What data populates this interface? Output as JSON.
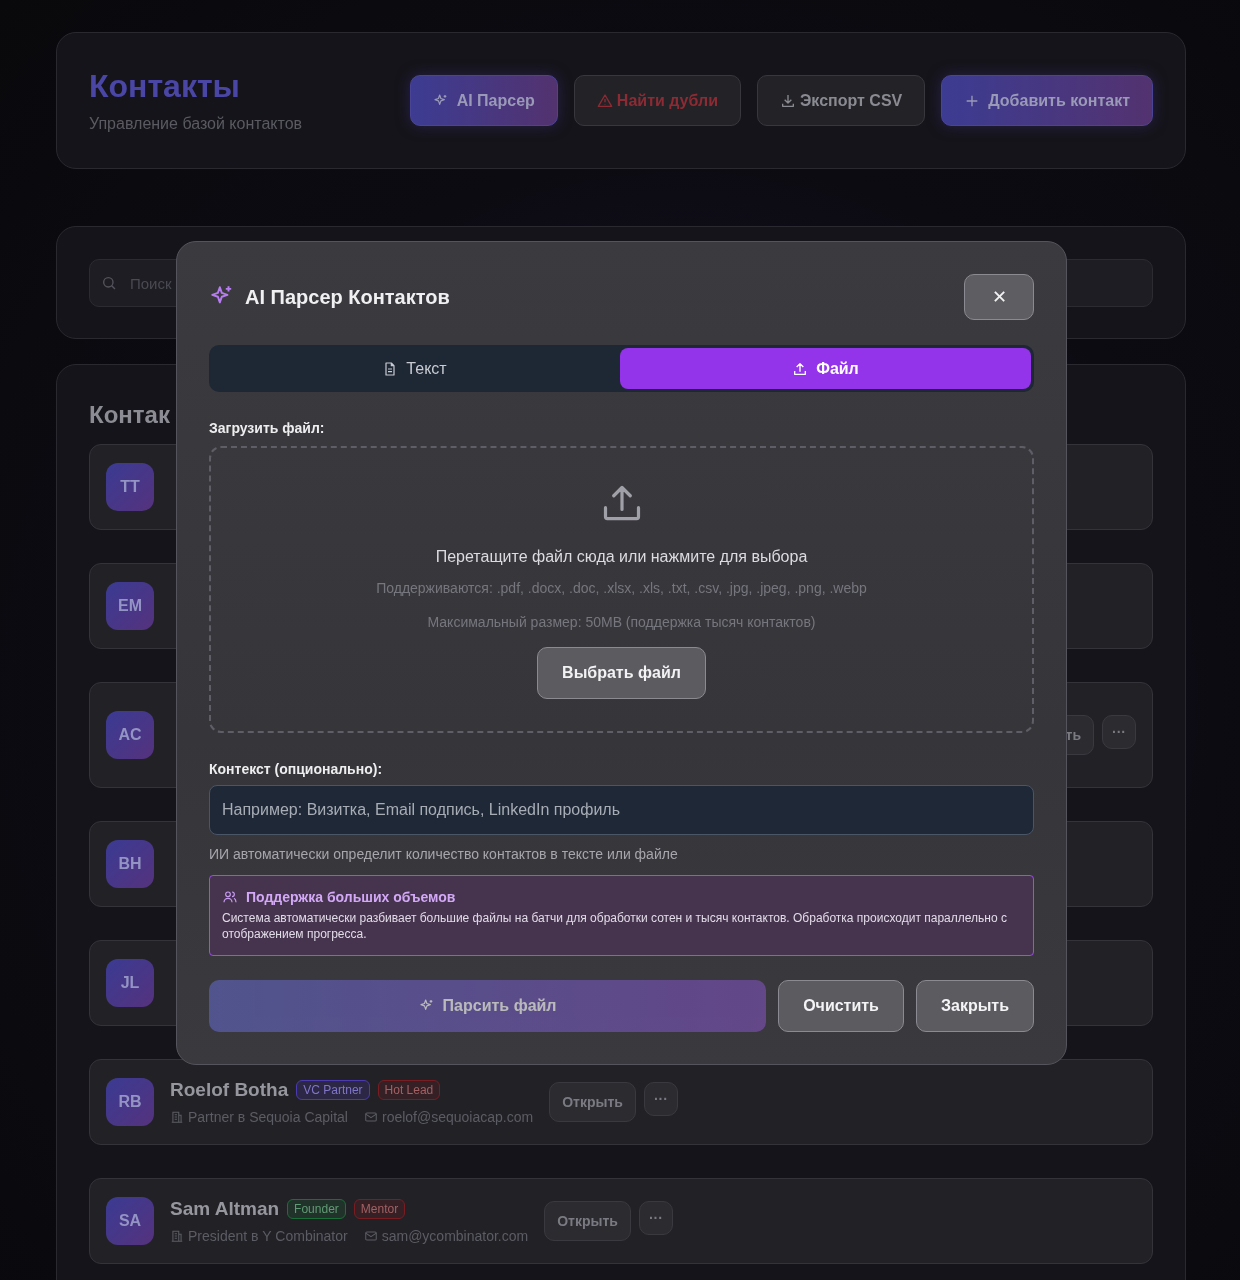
{
  "header": {
    "title": "Контакты",
    "subtitle": "Управление базой контактов",
    "buttons": [
      {
        "kind": "gradient",
        "label": "AI Парсер"
      },
      {
        "kind": "danger",
        "label": "Найти дубли"
      },
      {
        "kind": "plain",
        "label": "Экспорт CSV"
      },
      {
        "kind": "gradient",
        "label": "Добавить контакт"
      }
    ]
  },
  "search": {
    "placeholder": "Поиск"
  },
  "contacts": {
    "heading": "Контак",
    "rows": [
      {
        "initials": "TT"
      },
      {
        "initials": "EM"
      },
      {
        "initials": "AC",
        "actions": [
          {
            "kind": "open",
            "label": "ть"
          },
          {
            "kind": "more",
            "label": "···"
          }
        ]
      },
      {
        "initials": "BH"
      },
      {
        "initials": "JL"
      },
      {
        "initials": "RB",
        "name": "Roelof Botha",
        "tags": [
          {
            "label": "VC Partner",
            "color": "#4a3bb0"
          },
          {
            "label": "Hot Lead",
            "color": "#7a1d22"
          }
        ],
        "position": "Partner в Sequoia Capital",
        "email": "roelof@sequoiacap.com",
        "actions": [
          {
            "kind": "open",
            "label": "Открыть"
          },
          {
            "kind": "more",
            "label": "···"
          }
        ]
      },
      {
        "initials": "SA",
        "name": "Sam Altman",
        "tags": [
          {
            "label": "Founder",
            "color": "#1c6e38"
          },
          {
            "label": "Mentor",
            "color": "#7a1d22"
          }
        ],
        "position": "President в Y Combinator",
        "email": "sam@ycombinator.com",
        "actions": [
          {
            "kind": "open",
            "label": "Открыть"
          },
          {
            "kind": "more",
            "label": "···"
          }
        ]
      }
    ]
  },
  "modal": {
    "title": "AI Парсер Контактов",
    "close": "✕",
    "tabs": [
      {
        "label": "Текст",
        "selected": false
      },
      {
        "label": "Файл",
        "selected": true
      }
    ],
    "upload_label": "Загрузить файл:",
    "dropzone": {
      "prompt": "Перетащите файл сюда или нажмите для выбора",
      "formats": "Поддерживаются: .pdf, .docx, .doc, .xlsx, .xls, .txt, .csv, .jpg, .jpeg, .png, .webp",
      "max_size": "Максимальный размер: 50MB (поддержка тысяч контактов)",
      "button": "Выбрать файл"
    },
    "context_label": "Контекст (опционально):",
    "context": {
      "placeholder": "Например: Визитка, Email подпись, LinkedIn профиль"
    },
    "hint": "ИИ автоматически определит количество контактов в тексте или файле",
    "info": {
      "title": "Поддержка больших объемов",
      "text": "Система автоматически разбивает большие файлы на батчи для обработки сотен и тысяч контактов. Обработка происходит параллельно с отображением прогресса."
    },
    "actions": [
      {
        "kind": "primary",
        "label": "Парсить файл",
        "disabled": true
      },
      {
        "kind": "secondary",
        "label": "Очистить",
        "disabled": false
      },
      {
        "kind": "secondary",
        "label": "Закрыть",
        "disabled": false
      }
    ]
  }
}
